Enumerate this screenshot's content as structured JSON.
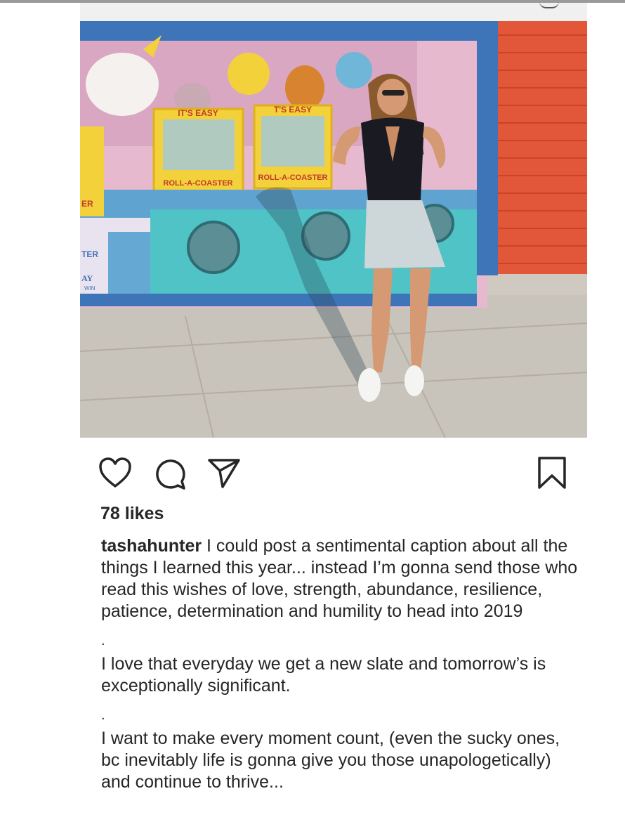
{
  "post": {
    "username": "tashahunter",
    "likes": "78 likes",
    "caption_first": " I could post a sentimental caption about all the things I learned this year... instead I’m gonna send those who read this wishes of love, strength, abundance, resilience, patience, determination and humility to head into 2019",
    "separator_1": ".",
    "paragraph_2": "I love that everyday we get a new slate and tomorrow’s is exceptionally significant.",
    "separator_2": ".",
    "paragraph_3": "I want to make every moment count, (even the sucky ones, bc inevitably life is gonna give you those unapologetically) and continue to thrive..."
  },
  "photo": {
    "sign_left": "IT'S EASY",
    "sign_right": "T'S EASY",
    "game_left": "ROLL-A-COASTER",
    "game_right": "ROLL-A-COASTER",
    "edge_text_1": "ER",
    "edge_text_2": "TER",
    "edge_text_3": "AY",
    "edge_text_4": "WIN"
  },
  "icons": {
    "like": "heart-icon",
    "comment": "comment-icon",
    "share": "paper-plane-icon",
    "save": "bookmark-icon"
  },
  "colors": {
    "text": "#262626",
    "booth_teal": "#4fb8c8",
    "shutter_red": "#e2573a",
    "booth_yellow": "#f2d13a"
  }
}
